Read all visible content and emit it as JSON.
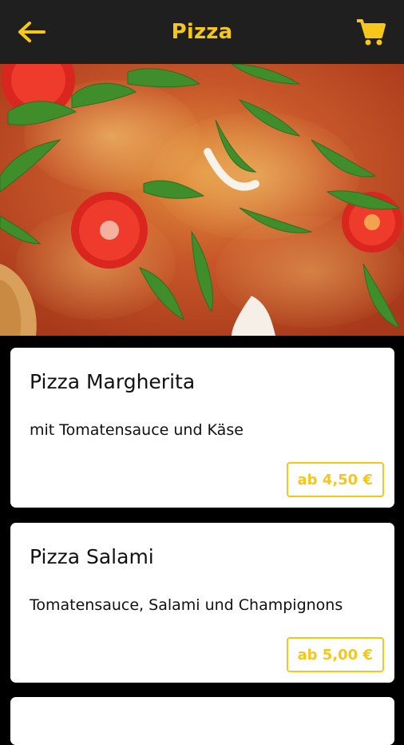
{
  "header": {
    "title": "Pizza",
    "back_icon": "arrow-left-icon",
    "cart_icon": "shopping-cart-icon",
    "accent_color": "#f6c71a",
    "bar_color": "#1f1f1f"
  },
  "hero": {
    "image_icon": "pizza-photo"
  },
  "menu": {
    "items": [
      {
        "name": "Pizza Margherita",
        "description": "mit Tomatensauce und Käse",
        "price": "ab 4,50 €"
      },
      {
        "name": "Pizza Salami",
        "description": "Tomatensauce, Salami und Champignons",
        "price": "ab 5,00 €"
      }
    ]
  }
}
